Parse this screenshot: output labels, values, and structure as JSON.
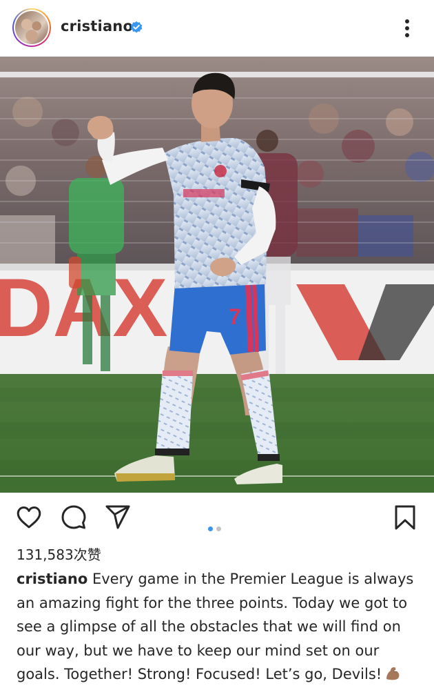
{
  "post": {
    "username": "cristiano",
    "verified": true,
    "likes": "131,583次赞",
    "caption_user": "cristiano",
    "caption_text": "Every game in the Premier League is always an amazing fight for the three points. Today we got to see a glimpse of all the obstacles that we will find on our way, but we have to keep our mind set on our goals. Together! Strong! Focused! Let’s go, Devils!",
    "caption_emoji": "flexed-biceps-icon",
    "carousel": {
      "total": 2,
      "current": 1
    },
    "photo_text": {
      "shirt_number": "7",
      "ad_board": "DAX"
    }
  },
  "icons": {
    "more": "more-vertical-icon",
    "like": "heart-icon",
    "comment": "comment-icon",
    "share": "send-icon",
    "save": "bookmark-icon",
    "verified": "verified-badge-icon"
  },
  "colors": {
    "verified_blue": "#3897f0",
    "text": "#262626",
    "dot_active": "#3897f0",
    "dot_inactive": "#c4c4c4"
  }
}
